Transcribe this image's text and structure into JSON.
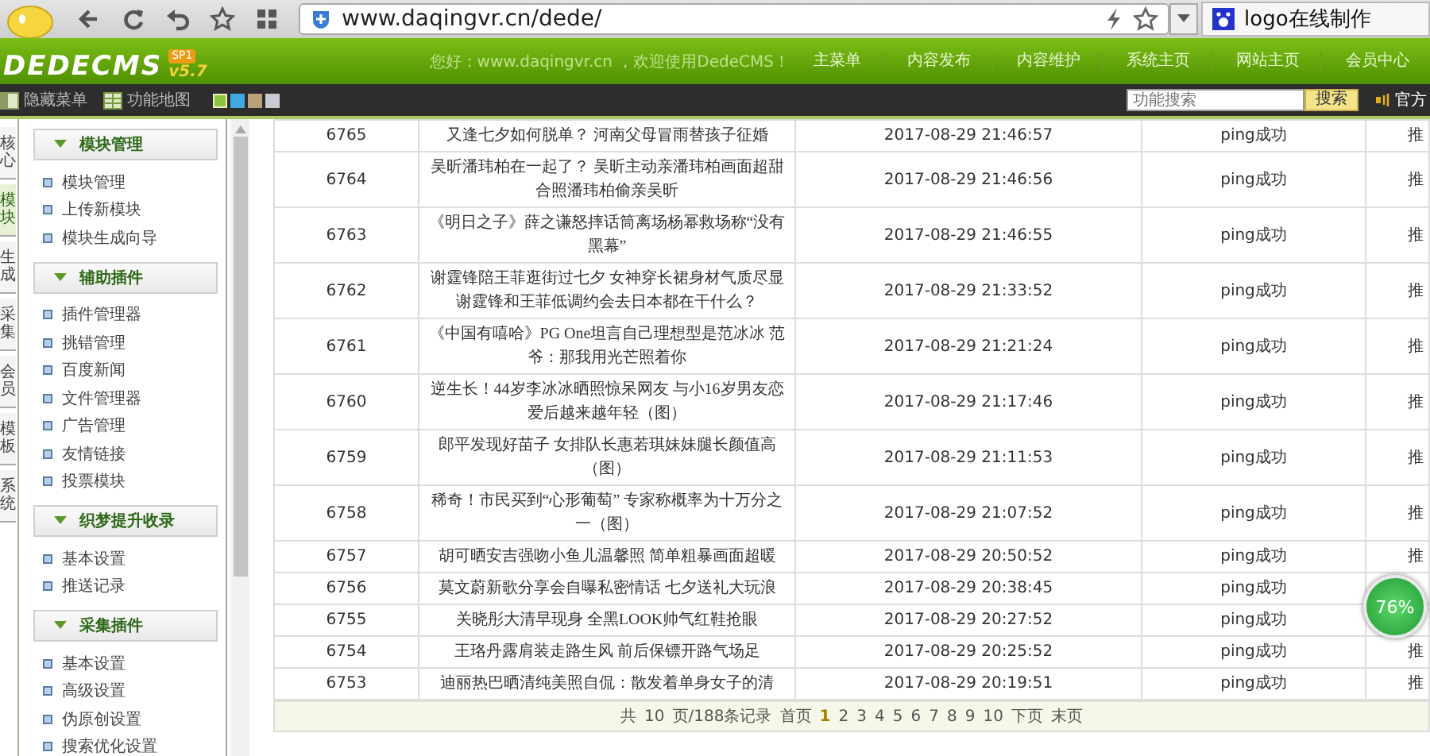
{
  "browser": {
    "url": "www.daqingvr.cn/dede/",
    "search": "logo在线制作"
  },
  "header": {
    "logo": "DEDECMS",
    "badge": "SP1",
    "version": "v5.7",
    "greeting": "您好：www.daqingvr.cn ，欢迎使用DedeCMS！",
    "nav": [
      "主菜单",
      "内容发布",
      "内容维护",
      "系统主页",
      "网站主页",
      "会员中心"
    ]
  },
  "toolbar": {
    "hide_menu": "隐藏菜单",
    "function_map": "功能地图",
    "themes": [
      {
        "color": "#8cc63f",
        "selected": true
      },
      {
        "color": "#3fa9e0",
        "selected": false
      },
      {
        "color": "#b8a27a",
        "selected": false
      },
      {
        "color": "#c8ccd0",
        "selected": false
      }
    ],
    "search": {
      "placeholder": "功能搜索"
    },
    "search_button": "搜索",
    "forum": "官方"
  },
  "side_tabs": [
    {
      "label": "核心",
      "selected": false
    },
    {
      "label": "模块",
      "selected": true
    },
    {
      "label": "生成",
      "selected": false
    },
    {
      "label": "采集",
      "selected": false
    },
    {
      "label": "会员",
      "selected": false
    },
    {
      "label": "模板",
      "selected": false
    },
    {
      "label": "系统",
      "selected": false
    }
  ],
  "sidebar": [
    {
      "title": "模块管理",
      "expanded": true,
      "items": [
        "模块管理",
        "上传新模块",
        "模块生成向导"
      ]
    },
    {
      "title": "辅助插件",
      "expanded": true,
      "items": [
        "插件管理器",
        "挑错管理",
        "百度新闻",
        "文件管理器",
        "广告管理",
        "友情链接",
        "投票模块"
      ]
    },
    {
      "title": "织梦提升收录",
      "expanded": true,
      "items": [
        "基本设置",
        "推送记录"
      ]
    },
    {
      "title": "采集插件",
      "expanded": true,
      "items": [
        "基本设置",
        "高级设置",
        "伪原创设置",
        "搜索优化设置"
      ]
    }
  ],
  "table": {
    "rows": [
      {
        "id": "6765",
        "title": "又逢七夕如何脱单？ 河南父母冒雨替孩子征婚",
        "time": "2017-08-29 21:46:57",
        "status": "ping成功",
        "column_5": "推"
      },
      {
        "id": "6764",
        "title": "吴昕潘玮柏在一起了？ 吴昕主动亲潘玮柏画面超甜合照潘玮柏偷亲吴昕",
        "time": "2017-08-29 21:46:56",
        "status": "ping成功",
        "column_5": "推"
      },
      {
        "id": "6763",
        "title": "《明日之子》薛之谦怒摔话筒离场杨幂救场称“没有黑幕”",
        "time": "2017-08-29 21:46:55",
        "status": "ping成功",
        "column_5": "推"
      },
      {
        "id": "6762",
        "title": "谢霆锋陪王菲逛街过七夕 女神穿长裙身材气质尽显谢霆锋和王菲低调约会去日本都在干什么？",
        "time": "2017-08-29 21:33:52",
        "status": "ping成功",
        "column_5": "推"
      },
      {
        "id": "6761",
        "title": "《中国有嘻哈》PG One坦言自己理想型是范冰冰 范爷：那我用光芒照着你",
        "time": "2017-08-29 21:21:24",
        "status": "ping成功",
        "column_5": "推"
      },
      {
        "id": "6760",
        "title": "逆生长！44岁李冰冰晒照惊呆网友 与小16岁男友恋爱后越来越年轻（图）",
        "time": "2017-08-29 21:17:46",
        "status": "ping成功",
        "column_5": "推"
      },
      {
        "id": "6759",
        "title": "郎平发现好苗子 女排队长惠若琪妹妹腿长颜值高（图）",
        "time": "2017-08-29 21:11:53",
        "status": "ping成功",
        "column_5": "推"
      },
      {
        "id": "6758",
        "title": "稀奇！市民买到“心形葡萄” 专家称概率为十万分之一（图）",
        "time": "2017-08-29 21:07:52",
        "status": "ping成功",
        "column_5": "推"
      },
      {
        "id": "6757",
        "title": "胡可晒安吉强吻小鱼儿温馨照 简单粗暴画面超暖",
        "time": "2017-08-29 20:50:52",
        "status": "ping成功",
        "column_5": "推"
      },
      {
        "id": "6756",
        "title": "莫文蔚新歌分享会自曝私密情话 七夕送礼大玩浪",
        "time": "2017-08-29 20:38:45",
        "status": "ping成功"
      },
      {
        "id": "6755",
        "title": "关晓彤大清早现身 全黑LOOK帅气红鞋抢眼",
        "time": "2017-08-29 20:27:52",
        "status": "ping成功"
      },
      {
        "id": "6754",
        "title": "王珞丹露肩装走路生风 前后保镖开路气场足",
        "time": "2017-08-29 20:25:52",
        "status": "ping成功",
        "column_5": "推"
      },
      {
        "id": "6753",
        "title": "迪丽热巴晒清纯美照自侃：散发着单身女子的清",
        "time": "2017-08-29 20:19:51",
        "status": "ping成功",
        "column_5": "推"
      }
    ]
  },
  "pagination": {
    "summary_parts": [
      "共",
      "10",
      "页/188条记录"
    ],
    "first": "首页",
    "pages": [
      {
        "label": "1",
        "selected": true
      },
      {
        "label": "2",
        "selected": false
      },
      {
        "label": "3",
        "selected": false
      },
      {
        "label": "4",
        "selected": false
      },
      {
        "label": "5",
        "selected": false
      },
      {
        "label": "6",
        "selected": false
      },
      {
        "label": "7",
        "selected": false
      },
      {
        "label": "8",
        "selected": false
      },
      {
        "label": "9",
        "selected": false
      },
      {
        "label": "10",
        "selected": false
      }
    ],
    "next": "下页",
    "last": "末页"
  },
  "speed_widget": {
    "text": "76%"
  }
}
